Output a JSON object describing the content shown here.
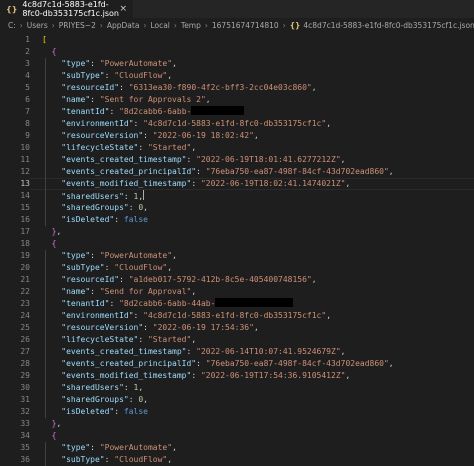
{
  "tab": {
    "title": "4c8d7c1d-5883-e1fd-8fc0-db353175cf1c.json",
    "icon": "json-braces-icon"
  },
  "breadcrumb": {
    "segments": [
      "C:",
      "Users",
      "PRIYES~2",
      "AppData",
      "Local",
      "Temp",
      "16751674714810"
    ],
    "file": "4c8d7c1d-5883-e1fd-8fc0-db353175cf1c.json"
  },
  "editor": {
    "active_line": 13,
    "lines": [
      {
        "n": 1,
        "tokens": [
          {
            "t": "[",
            "c": "b1"
          }
        ]
      },
      {
        "n": 2,
        "tokens": [
          {
            "t": "  "
          },
          {
            "t": "{",
            "c": "b2"
          }
        ]
      },
      {
        "n": 3,
        "tokens": [
          {
            "t": "    "
          },
          {
            "t": "\"type\"",
            "c": "k"
          },
          {
            "t": ": "
          },
          {
            "t": "\"PowerAutomate\"",
            "c": "s"
          },
          {
            "t": ","
          }
        ]
      },
      {
        "n": 4,
        "tokens": [
          {
            "t": "    "
          },
          {
            "t": "\"subType\"",
            "c": "k"
          },
          {
            "t": ": "
          },
          {
            "t": "\"CloudFlow\"",
            "c": "s"
          },
          {
            "t": ","
          }
        ]
      },
      {
        "n": 5,
        "tokens": [
          {
            "t": "    "
          },
          {
            "t": "\"resourceId\"",
            "c": "k"
          },
          {
            "t": ": "
          },
          {
            "t": "\"6313ea30-f890-4f2c-bff3-2cc04e03c860\"",
            "c": "s"
          },
          {
            "t": ","
          }
        ]
      },
      {
        "n": 6,
        "tokens": [
          {
            "t": "    "
          },
          {
            "t": "\"name\"",
            "c": "k"
          },
          {
            "t": ": "
          },
          {
            "t": "\"Sent for Approvals 2\"",
            "c": "s"
          },
          {
            "t": ","
          }
        ]
      },
      {
        "n": 7,
        "tokens": [
          {
            "t": "    "
          },
          {
            "t": "\"tenantId\"",
            "c": "k"
          },
          {
            "t": ": "
          },
          {
            "t": "\"8d2cabb6-6abb-",
            "c": "s"
          },
          {
            "redact": 11
          }
        ]
      },
      {
        "n": 8,
        "tokens": [
          {
            "t": "    "
          },
          {
            "t": "\"environmentId\"",
            "c": "k"
          },
          {
            "t": ": "
          },
          {
            "t": "\"4c8d7c1d-5883-e1fd-8fc0-db353175cf1c\"",
            "c": "s"
          },
          {
            "t": ","
          }
        ]
      },
      {
        "n": 9,
        "tokens": [
          {
            "t": "    "
          },
          {
            "t": "\"resourceVersion\"",
            "c": "k"
          },
          {
            "t": ": "
          },
          {
            "t": "\"2022-06-19 18:02:42\"",
            "c": "s"
          },
          {
            "t": ","
          }
        ]
      },
      {
        "n": 10,
        "tokens": [
          {
            "t": "    "
          },
          {
            "t": "\"lifecycleState\"",
            "c": "k"
          },
          {
            "t": ": "
          },
          {
            "t": "\"Started\"",
            "c": "s"
          },
          {
            "t": ","
          }
        ]
      },
      {
        "n": 11,
        "tokens": [
          {
            "t": "    "
          },
          {
            "t": "\"events_created_timestamp\"",
            "c": "k"
          },
          {
            "t": ": "
          },
          {
            "t": "\"2022-06-19T18:01:41.6277212Z\"",
            "c": "s"
          },
          {
            "t": ","
          }
        ]
      },
      {
        "n": 12,
        "tokens": [
          {
            "t": "    "
          },
          {
            "t": "\"events_created_principalId\"",
            "c": "k"
          },
          {
            "t": ": "
          },
          {
            "t": "\"76eba750-ea87-498f-84cf-43d702ead860\"",
            "c": "s"
          },
          {
            "t": ","
          }
        ]
      },
      {
        "n": 13,
        "tokens": [
          {
            "t": "    "
          },
          {
            "t": "\"events_modified_timestamp\"",
            "c": "k"
          },
          {
            "t": ": "
          },
          {
            "t": "\"2022-06-19T18:02:41.1474021Z\"",
            "c": "s"
          },
          {
            "t": ","
          }
        ]
      },
      {
        "n": 14,
        "tokens": [
          {
            "t": "    "
          },
          {
            "t": "\"sharedUsers\"",
            "c": "k"
          },
          {
            "t": ": "
          },
          {
            "t": "1",
            "c": "n"
          },
          {
            "t": ","
          },
          {
            "cursor": true
          }
        ]
      },
      {
        "n": 15,
        "tokens": [
          {
            "t": "    "
          },
          {
            "t": "\"sharedGroups\"",
            "c": "k"
          },
          {
            "t": ": "
          },
          {
            "t": "0",
            "c": "n"
          },
          {
            "t": ","
          }
        ]
      },
      {
        "n": 16,
        "tokens": [
          {
            "t": "    "
          },
          {
            "t": "\"isDeleted\"",
            "c": "k"
          },
          {
            "t": ": "
          },
          {
            "t": "false",
            "c": "kw"
          }
        ]
      },
      {
        "n": 17,
        "tokens": [
          {
            "t": "  "
          },
          {
            "t": "}",
            "c": "b2"
          },
          {
            "t": ","
          }
        ]
      },
      {
        "n": 18,
        "tokens": [
          {
            "t": "  "
          },
          {
            "t": "{",
            "c": "b2"
          }
        ]
      },
      {
        "n": 19,
        "tokens": [
          {
            "t": "    "
          },
          {
            "t": "\"type\"",
            "c": "k"
          },
          {
            "t": ": "
          },
          {
            "t": "\"PowerAutomate\"",
            "c": "s"
          },
          {
            "t": ","
          }
        ]
      },
      {
        "n": 20,
        "tokens": [
          {
            "t": "    "
          },
          {
            "t": "\"subType\"",
            "c": "k"
          },
          {
            "t": ": "
          },
          {
            "t": "\"CloudFlow\"",
            "c": "s"
          },
          {
            "t": ","
          }
        ]
      },
      {
        "n": 21,
        "tokens": [
          {
            "t": "    "
          },
          {
            "t": "\"resourceId\"",
            "c": "k"
          },
          {
            "t": ": "
          },
          {
            "t": "\"a1deb017-5792-412b-8c5e-405400748156\"",
            "c": "s"
          },
          {
            "t": ","
          }
        ]
      },
      {
        "n": 22,
        "tokens": [
          {
            "t": "    "
          },
          {
            "t": "\"name\"",
            "c": "k"
          },
          {
            "t": ": "
          },
          {
            "t": "\"Send for Approval\"",
            "c": "s"
          },
          {
            "t": ","
          }
        ]
      },
      {
        "n": 23,
        "tokens": [
          {
            "t": "    "
          },
          {
            "t": "\"tenantId\"",
            "c": "k"
          },
          {
            "t": ": "
          },
          {
            "t": "\"8d2cabb6-6abb-44ab-",
            "c": "s"
          },
          {
            "redact": 16
          }
        ]
      },
      {
        "n": 24,
        "tokens": [
          {
            "t": "    "
          },
          {
            "t": "\"environmentId\"",
            "c": "k"
          },
          {
            "t": ": "
          },
          {
            "t": "\"4c8d7c1d-5883-e1fd-8fc0-db353175cf1c\"",
            "c": "s"
          },
          {
            "t": ","
          }
        ]
      },
      {
        "n": 25,
        "tokens": [
          {
            "t": "    "
          },
          {
            "t": "\"resourceVersion\"",
            "c": "k"
          },
          {
            "t": ": "
          },
          {
            "t": "\"2022-06-19 17:54:36\"",
            "c": "s"
          },
          {
            "t": ","
          }
        ]
      },
      {
        "n": 26,
        "tokens": [
          {
            "t": "    "
          },
          {
            "t": "\"lifecycleState\"",
            "c": "k"
          },
          {
            "t": ": "
          },
          {
            "t": "\"Started\"",
            "c": "s"
          },
          {
            "t": ","
          }
        ]
      },
      {
        "n": 27,
        "tokens": [
          {
            "t": "    "
          },
          {
            "t": "\"events_created_timestamp\"",
            "c": "k"
          },
          {
            "t": ": "
          },
          {
            "t": "\"2022-06-14T10:07:41.9524679Z\"",
            "c": "s"
          },
          {
            "t": ","
          }
        ]
      },
      {
        "n": 28,
        "tokens": [
          {
            "t": "    "
          },
          {
            "t": "\"events_created_principalId\"",
            "c": "k"
          },
          {
            "t": ": "
          },
          {
            "t": "\"76eba750-ea87-498f-84cf-43d702ead860\"",
            "c": "s"
          },
          {
            "t": ","
          }
        ]
      },
      {
        "n": 29,
        "tokens": [
          {
            "t": "    "
          },
          {
            "t": "\"events_modified_timestamp\"",
            "c": "k"
          },
          {
            "t": ": "
          },
          {
            "t": "\"2022-06-19T17:54:36.9105412Z\"",
            "c": "s"
          },
          {
            "t": ","
          }
        ]
      },
      {
        "n": 30,
        "tokens": [
          {
            "t": "    "
          },
          {
            "t": "\"sharedUsers\"",
            "c": "k"
          },
          {
            "t": ": "
          },
          {
            "t": "1",
            "c": "n"
          },
          {
            "t": ","
          }
        ]
      },
      {
        "n": 31,
        "tokens": [
          {
            "t": "    "
          },
          {
            "t": "\"sharedGroups\"",
            "c": "k"
          },
          {
            "t": ": "
          },
          {
            "t": "0",
            "c": "n"
          },
          {
            "t": ","
          }
        ]
      },
      {
        "n": 32,
        "tokens": [
          {
            "t": "    "
          },
          {
            "t": "\"isDeleted\"",
            "c": "k"
          },
          {
            "t": ": "
          },
          {
            "t": "false",
            "c": "kw"
          }
        ]
      },
      {
        "n": 33,
        "tokens": [
          {
            "t": "  "
          },
          {
            "t": "}",
            "c": "b2"
          },
          {
            "t": ","
          }
        ]
      },
      {
        "n": 34,
        "tokens": [
          {
            "t": "  "
          },
          {
            "t": "{",
            "c": "b2"
          }
        ]
      },
      {
        "n": 35,
        "tokens": [
          {
            "t": "    "
          },
          {
            "t": "\"type\"",
            "c": "k"
          },
          {
            "t": ": "
          },
          {
            "t": "\"PowerAutomate\"",
            "c": "s"
          },
          {
            "t": ","
          }
        ]
      },
      {
        "n": 36,
        "tokens": [
          {
            "t": "    "
          },
          {
            "t": "\"subType\"",
            "c": "k"
          },
          {
            "t": ": "
          },
          {
            "t": "\"CloudFlow\"",
            "c": "s"
          },
          {
            "t": ","
          }
        ]
      }
    ]
  },
  "colors": {
    "background": "#1e1e1e",
    "key": "#9cdcfe",
    "string": "#ce9178",
    "number": "#b5cea8",
    "keyword": "#569cd6",
    "bracket_outer": "#ffd700",
    "bracket_inner": "#da70d6"
  }
}
